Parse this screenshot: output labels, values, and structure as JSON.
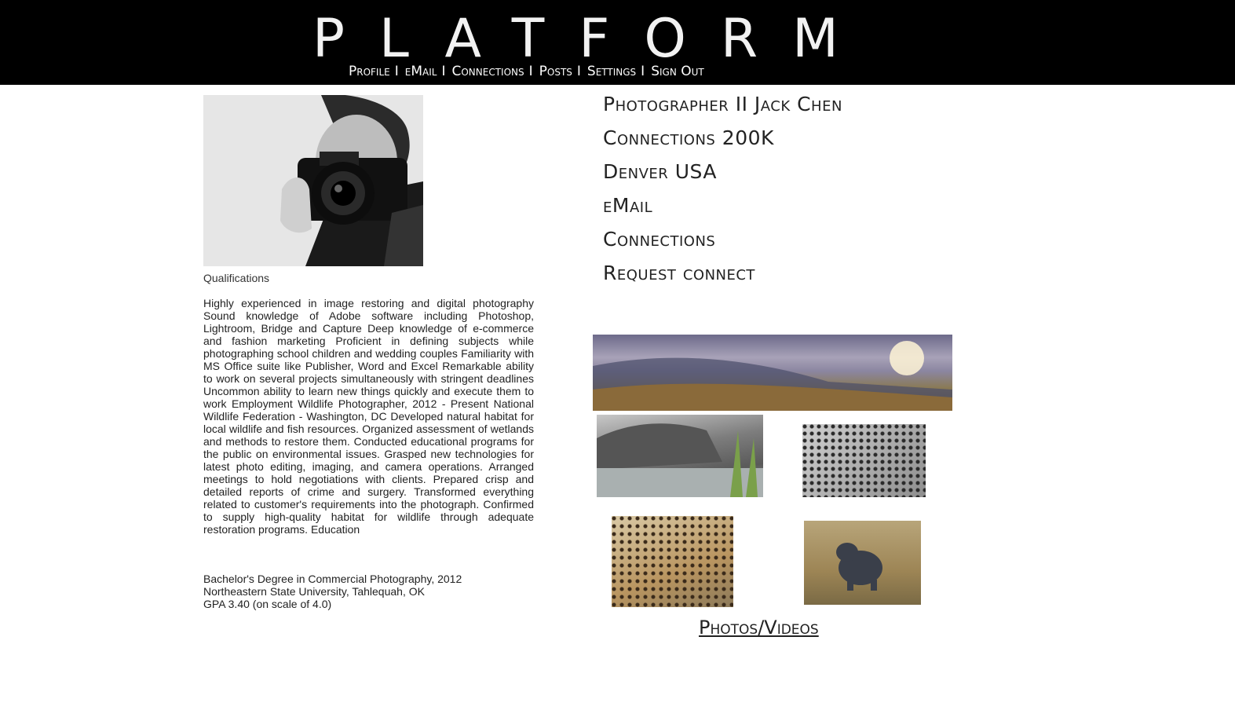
{
  "header": {
    "brand": "PLATFORM",
    "nav": [
      {
        "label": "Profile"
      },
      {
        "label": "eMail"
      },
      {
        "label": "Connections"
      },
      {
        "label": "Posts"
      },
      {
        "label": "Settings"
      },
      {
        "label": "Sign Out"
      }
    ],
    "separator": "I"
  },
  "profile": {
    "qualifications_title": "Qualifications",
    "qualifications_body": "Highly experienced in image restoring and digital photography Sound knowledge of Adobe software including Photoshop, Lightroom, Bridge and Capture Deep knowledge of e-commerce and fashion marketing Proficient in defining subjects while photographing school children and wedding couples Familiarity with MS Office suite like Publisher, Word and Excel Remarkable ability to work on several projects simultaneously with stringent deadlines Uncommon ability to learn new things quickly and execute them to work Employment Wildlife Photographer, 2012 - Present National Wildlife Federation - Washington, DC Developed natural habitat for local wildlife and fish resources. Organized assessment of wetlands and methods to restore them. Conducted educational programs for the public on environmental issues. Grasped new technologies for latest photo editing, imaging, and camera operations. Arranged meetings to hold negotiations with clients. Prepared crisp and detailed reports of crime and surgery. Transformed everything related to customer's requirements into the photograph. Confirmed to supply high-quality habitat for wildlife through adequate restoration programs. Education",
    "education": [
      "Bachelor's Degree in Commercial Photography, 2012",
      "Northeastern State University, Tahlequah, OK",
      "GPA 3.40 (on scale of 4.0)"
    ]
  },
  "info": {
    "title": "Photographer  II Jack Chen",
    "connections": "Connections 200K",
    "location": "Denver USA",
    "email_link": "eMail",
    "connections_link": "Connections",
    "request_link": "Request connect"
  },
  "gallery": {
    "link": "Photos/Videos "
  }
}
